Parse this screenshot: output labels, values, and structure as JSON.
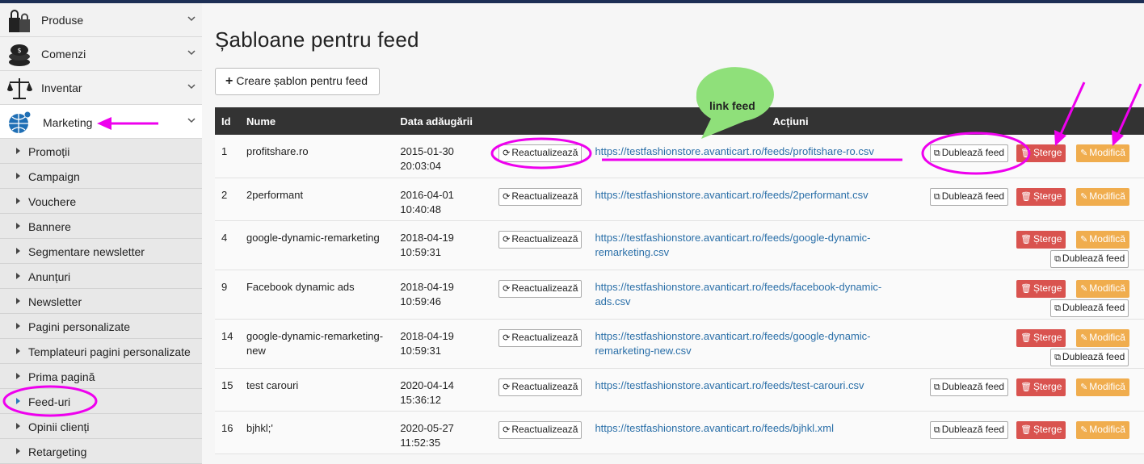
{
  "sidebar": {
    "menu": [
      {
        "label": "Produse",
        "icon": "shopping-bags-icon"
      },
      {
        "label": "Comenzi",
        "icon": "coins-icon"
      },
      {
        "label": "Inventar",
        "icon": "balance-scale-icon"
      },
      {
        "label": "Marketing",
        "icon": "globe-network-icon"
      }
    ],
    "submenu": [
      "Promoții",
      "Campaign",
      "Vouchere",
      "Bannere",
      "Segmentare newsletter",
      "Anunțuri",
      "Newsletter",
      "Pagini personalizate",
      "Templateuri pagini personalizate",
      "Prima pagină",
      "Feed-uri",
      "Opinii clienți",
      "Retargeting"
    ],
    "active_submenu": "Feed-uri"
  },
  "main": {
    "title": "Șabloane pentru feed",
    "create_button": "Creare șablon pentru feed",
    "table": {
      "headers": [
        "Id",
        "Nume",
        "Data adăugării",
        "Acțiuni"
      ],
      "refresh_label": "Reactualizează",
      "duplicate_label": "Dublează feed",
      "delete_label": "Șterge",
      "edit_label": "Modifică",
      "rows": [
        {
          "id": "1",
          "name": "profitshare.ro",
          "date": "2015-01-30",
          "time": "20:03:04",
          "url": "https://testfashionstore.avanticart.ro/feeds/profitshare-ro.csv"
        },
        {
          "id": "2",
          "name": "2performant",
          "date": "2016-04-01",
          "time": "10:40:48",
          "url": "https://testfashionstore.avanticart.ro/feeds/2performant.csv"
        },
        {
          "id": "4",
          "name": "google-dynamic-remarketing",
          "date": "2018-04-19",
          "time": "10:59:31",
          "url": "https://testfashionstore.avanticart.ro/feeds/google-dynamic-remarketing.csv"
        },
        {
          "id": "9",
          "name": "Facebook dynamic ads",
          "date": "2018-04-19",
          "time": "10:59:46",
          "url": "https://testfashionstore.avanticart.ro/feeds/facebook-dynamic-ads.csv"
        },
        {
          "id": "14",
          "name": "google-dynamic-remarketing-",
          "name2": "new",
          "date": "2018-04-19",
          "time": "10:59:31",
          "url": "https://testfashionstore.avanticart.ro/feeds/google-dynamic-remarketing-new.csv"
        },
        {
          "id": "15",
          "name": "test carouri",
          "date": "2020-04-14",
          "time": "15:36:12",
          "url": "https://testfashionstore.avanticart.ro/feeds/test-carouri.csv"
        },
        {
          "id": "16",
          "name": "bjhkl;'",
          "date": "2020-05-27",
          "time": "11:52:35",
          "url": "https://testfashionstore.avanticart.ro/feeds/bjhkl.xml"
        }
      ]
    }
  },
  "annotations": {
    "bubble_text": "link feed",
    "highlight_color": "#ee00ee",
    "bubble_color": "#8fe07a"
  }
}
